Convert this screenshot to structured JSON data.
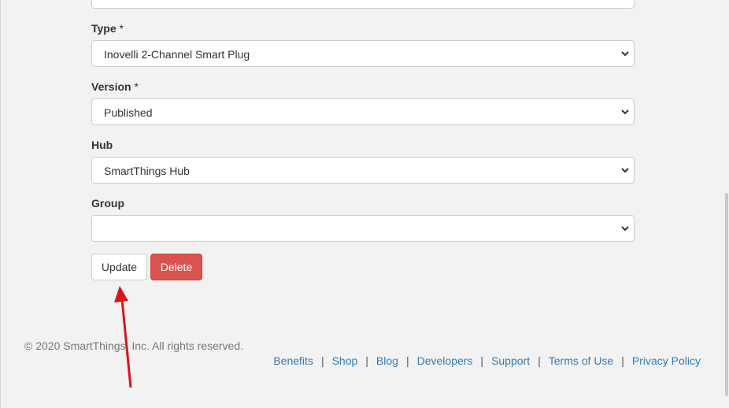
{
  "form": {
    "type": {
      "label": "Type",
      "required_mark": "*",
      "value": "Inovelli 2-Channel Smart Plug"
    },
    "version": {
      "label": "Version",
      "required_mark": "*",
      "value": "Published"
    },
    "hub": {
      "label": "Hub",
      "value": "SmartThings Hub"
    },
    "group": {
      "label": "Group",
      "value": ""
    },
    "update_label": "Update",
    "delete_label": "Delete"
  },
  "footer": {
    "copyright": "© 2020 SmartThings, Inc. All rights reserved.",
    "links": [
      "Benefits",
      "Shop",
      "Blog",
      "Developers",
      "Support",
      "Terms of Use",
      "Privacy Policy"
    ],
    "separator": "|"
  },
  "colors": {
    "background": "#f2f2f2",
    "delete_button": "#d9534f",
    "link": "#337ab7",
    "annotation_arrow": "#d9141b"
  },
  "icons": {
    "select_caret": "chevron-down-icon",
    "annotation": "red-arrow-annotation"
  }
}
